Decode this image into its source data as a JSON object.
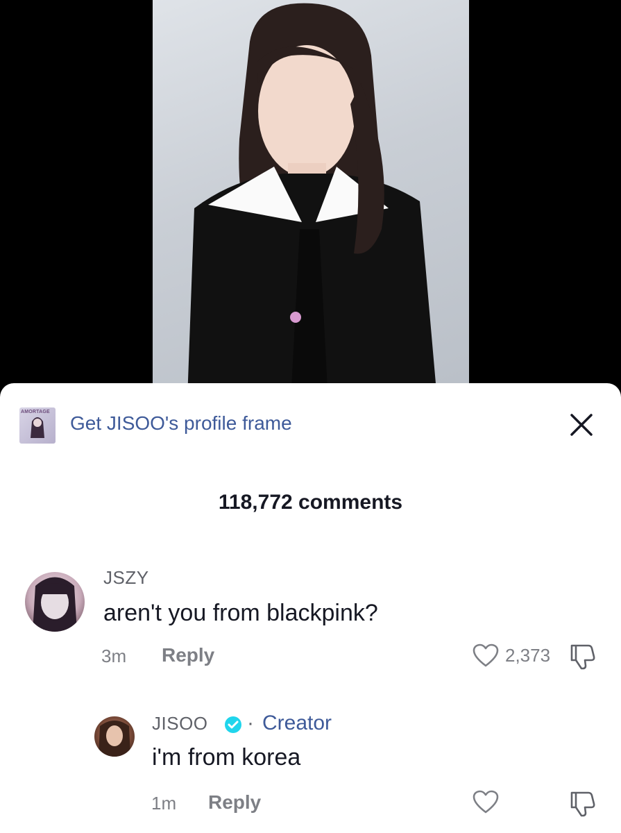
{
  "banner": {
    "text": "Get JISOO's profile frame",
    "thumb_brand": "AMORTAGE"
  },
  "comments_header": {
    "count_text": "118,772 comments"
  },
  "comments": [
    {
      "username": "JSZY",
      "text": "aren't you from blackpink?",
      "time": "3m",
      "reply_label": "Reply",
      "likes": "2,373"
    },
    {
      "username": "JISOO",
      "separator": "·",
      "badge": "Creator",
      "text": "i'm from korea",
      "time": "1m",
      "reply_label": "Reply"
    }
  ],
  "colors": {
    "link": "#3e5a99",
    "verified": "#20d5ec",
    "muted": "#7d7f85",
    "text": "#161823"
  },
  "icons": [
    "close-icon",
    "heart-icon",
    "dislike-icon",
    "verified-badge-icon"
  ]
}
